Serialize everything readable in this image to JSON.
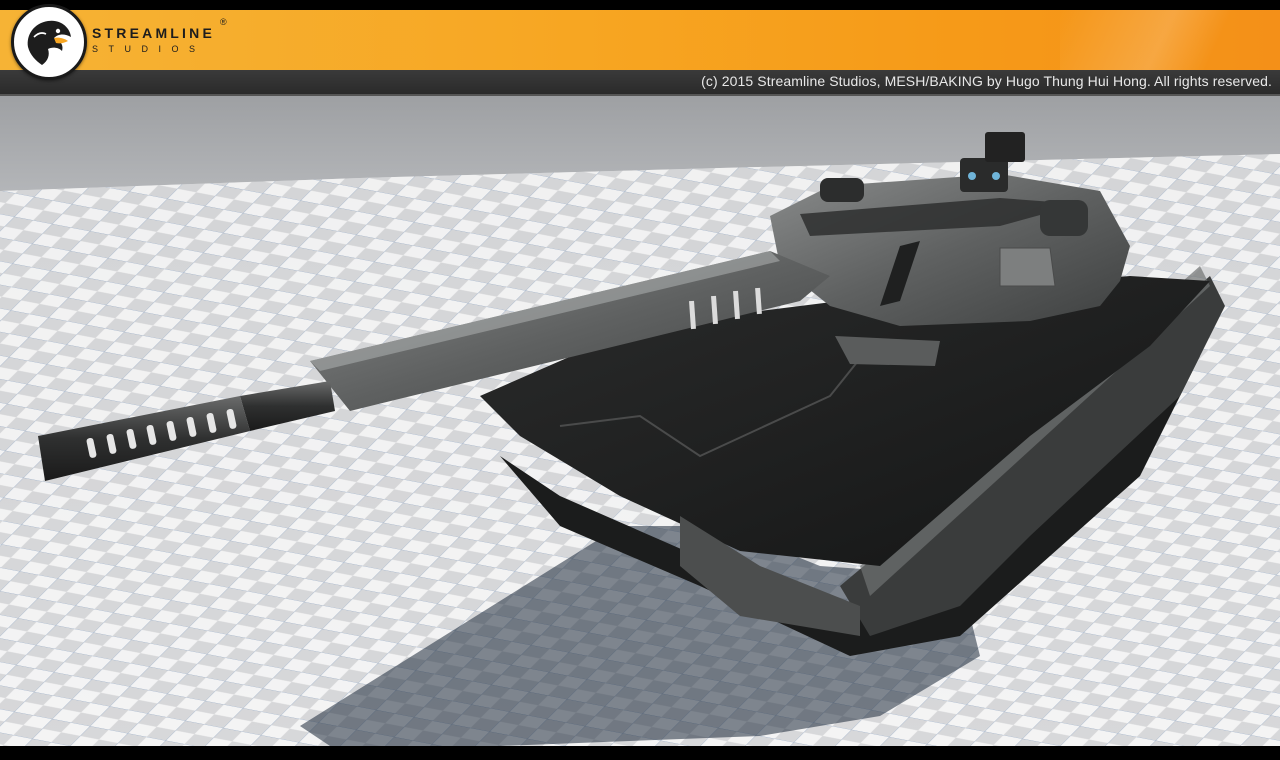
{
  "banner": {
    "logo_wordmark": "STREAMLINE",
    "logo_subtitle": "STUDIOS",
    "logo_registered": "®",
    "accent_color": "#f7a622"
  },
  "credit": {
    "text": "(c) 2015 Streamline Studios, MESH/BAKING by Hugo Thung Hui Hong. All rights reserved."
  },
  "scene": {
    "subject": "tank-model",
    "floor": "checker-grid",
    "colors": {
      "sky": "#a6a8ab",
      "grid_light": "#f4f4f4",
      "grid_dark": "#cfd0d2",
      "hull": "#2b2c2c"
    }
  }
}
